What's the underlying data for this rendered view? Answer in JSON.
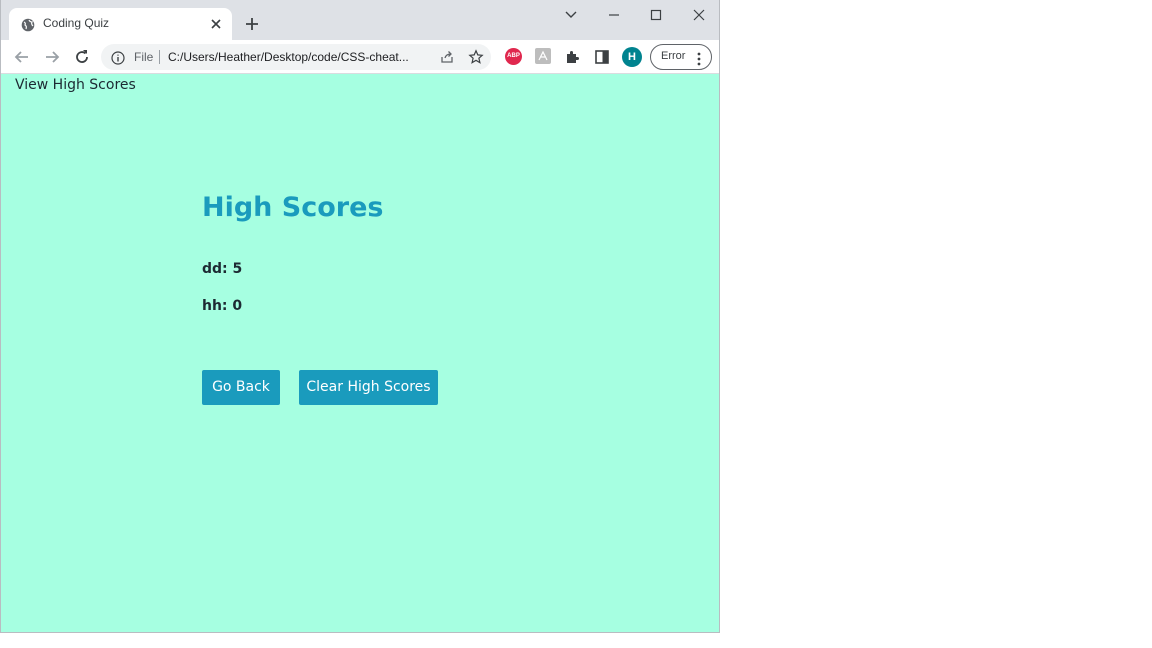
{
  "browser": {
    "tab_title": "Coding Quiz",
    "omnibox": {
      "scheme_label": "File",
      "url": "C:/Users/Heather/Desktop/code/CSS-cheat..."
    },
    "extensions": {
      "abp_label": "ABP"
    },
    "profile_initial": "H",
    "error_chip_label": "Error"
  },
  "page": {
    "nav_link": "View High Scores",
    "title": "High Scores",
    "scores": [
      {
        "text": "dd: 5"
      },
      {
        "text": "hh: 0"
      }
    ],
    "buttons": {
      "go_back": "Go Back",
      "clear": "Clear High Scores"
    }
  },
  "colors": {
    "page_background": "#a6ffe1",
    "accent": "#1a9bbd",
    "text": "#1d2a33"
  }
}
